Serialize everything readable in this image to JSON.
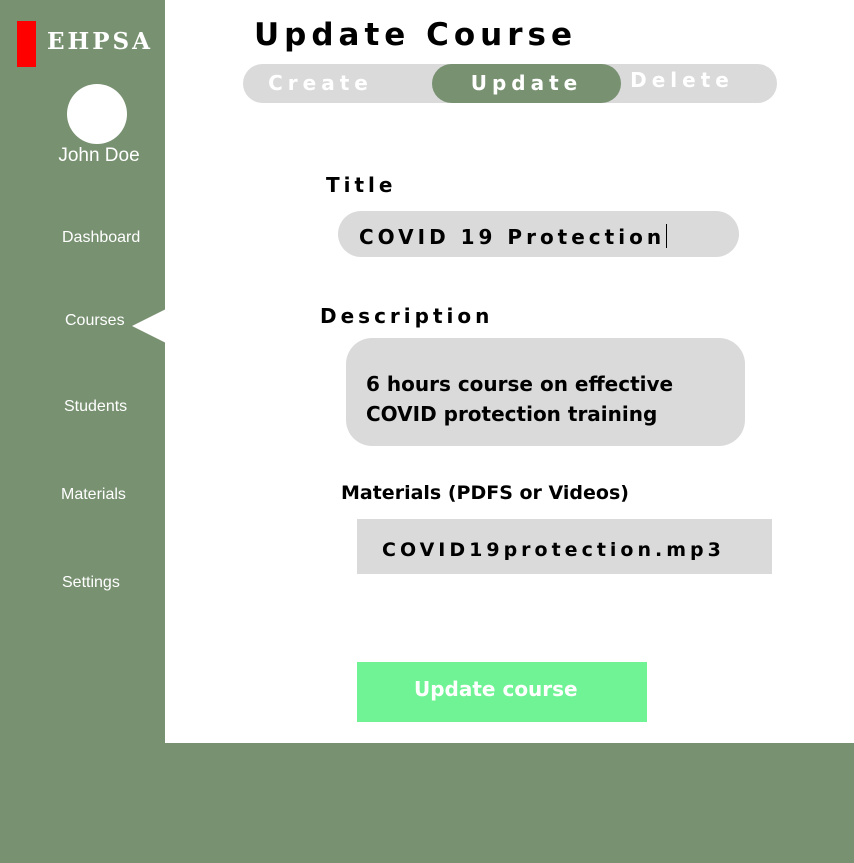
{
  "sidebar": {
    "logo_text": "EHPSA",
    "user_name": "John Doe",
    "items": [
      {
        "label": "Dashboard"
      },
      {
        "label": "Courses",
        "active": true
      },
      {
        "label": "Students"
      },
      {
        "label": "Materials"
      },
      {
        "label": "Settings"
      }
    ]
  },
  "page": {
    "title": "Update Course"
  },
  "tabs": [
    {
      "label": "Create"
    },
    {
      "label": "Update",
      "active": true
    },
    {
      "label": "Delete"
    }
  ],
  "form": {
    "title_label": "Title",
    "title_value": "COVID 19 Protection",
    "description_label": "Description",
    "description_value_line1": "6 hours course on effective",
    "description_value_line2": "COVID protection training",
    "materials_label": "Materials (PDFS or Videos)",
    "materials_value": "COVID19protection.mp3",
    "submit_label": "Update course"
  },
  "colors": {
    "sidebar_bg": "#789171",
    "accent_red": "#ff0000",
    "field_bg": "#dadada",
    "submit_bg": "#70f394"
  },
  "icons": {
    "avatar": "avatar-circle",
    "active_pointer": "triangle-pointer"
  }
}
